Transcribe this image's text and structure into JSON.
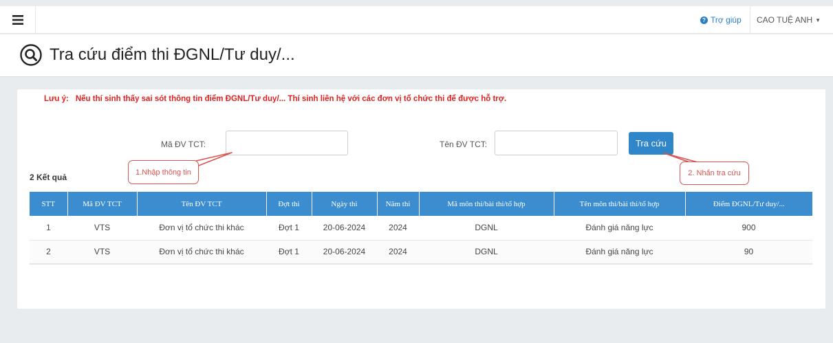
{
  "topbar": {
    "help_label": "Trợ giúp",
    "user_name": "CAO TUỆ ANH"
  },
  "header": {
    "title": "Tra cứu điểm thi ĐGNL/Tư duy/..."
  },
  "note": {
    "label": "Lưu ý:",
    "text": "Nếu thí sinh thấy sai sót thông tin điểm ĐGNL/Tư duy/... Thí sinh liên hệ với các đơn vị tổ chức thi để được hỗ trợ."
  },
  "form": {
    "ma_label": "Mã ĐV TCT:",
    "ma_value": "",
    "ten_label": "Tên ĐV TCT:",
    "ten_value": "",
    "search_button": "Tra cứu"
  },
  "callouts": {
    "step1": "1.Nhập thông tin",
    "step2": "2. Nhấn tra cứu"
  },
  "results": {
    "count_label": "2 Kết quả",
    "columns": [
      "STT",
      "Mã ĐV TCT",
      "Tên ĐV TCT",
      "Đợt thi",
      "Ngày thi",
      "Năm thi",
      "Mã môn thi/bài thi/tổ hợp",
      "Tên môn thi/bài thi/tổ hợp",
      "Điểm ĐGNL/Tư duy/..."
    ],
    "rows": [
      [
        "1",
        "VTS",
        "Đơn vị tổ chức thi khác",
        "Đợt 1",
        "20-06-2024",
        "2024",
        "DGNL",
        "Đánh giá năng lực",
        "900"
      ],
      [
        "2",
        "VTS",
        "Đơn vị tổ chức thi khác",
        "Đợt 1",
        "20-06-2024",
        "2024",
        "DGNL",
        "Đánh giá năng lực",
        "90"
      ]
    ]
  },
  "colors": {
    "accent": "#3c8dd0",
    "button": "#2f86c9",
    "warning": "#e02020",
    "callout": "#d9534f",
    "background": "#e9ecef"
  },
  "icons": {
    "menu": "hamburger-icon",
    "help": "question-circle-icon",
    "user_caret": "caret-down-icon",
    "title": "search-circle-icon"
  }
}
